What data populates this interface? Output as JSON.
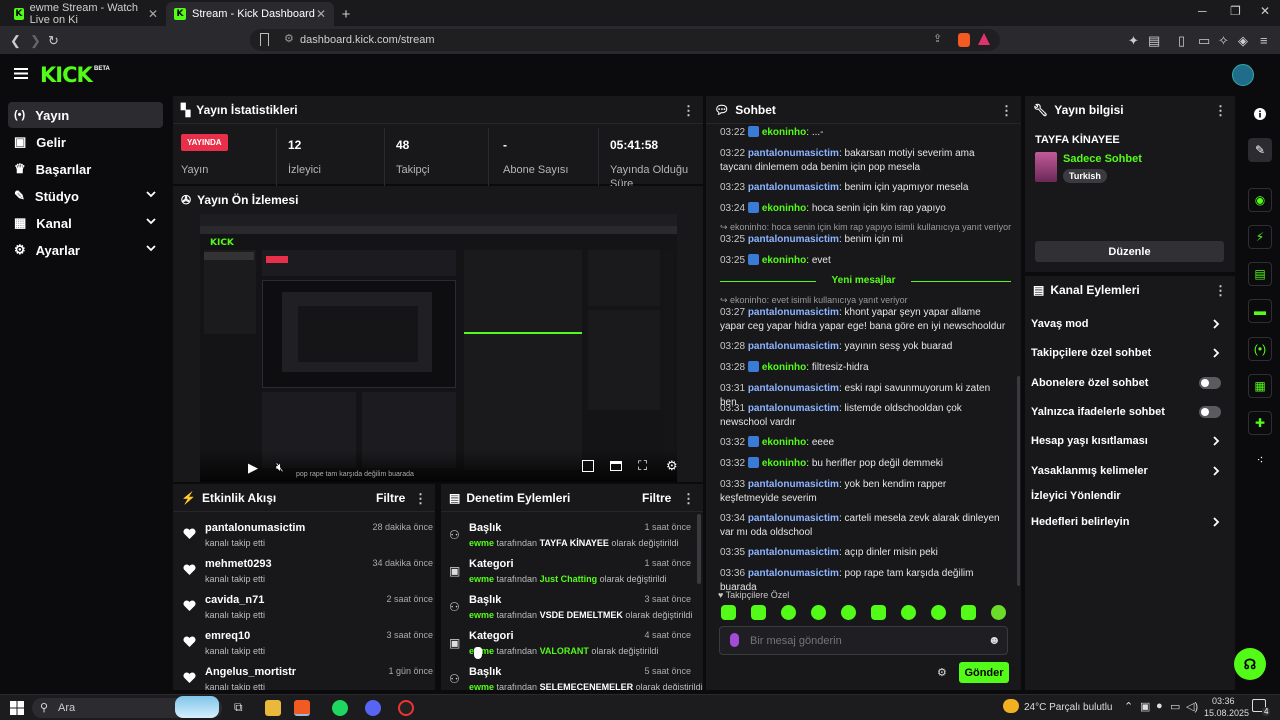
{
  "browser": {
    "tabs": [
      {
        "title": "ewme Stream - Watch Live on Ki"
      },
      {
        "title": "Stream - Kick Dashboard"
      }
    ],
    "url": "dashboard.kick.com/stream"
  },
  "site": {
    "logo": "KICK",
    "beta": "BETA"
  },
  "sidebar": {
    "items": [
      {
        "label": "Yayın",
        "icon": "broadcast-icon"
      },
      {
        "label": "Gelir",
        "icon": "money-icon"
      },
      {
        "label": "Başarılar",
        "icon": "trophy-icon"
      },
      {
        "label": "Stüdyo",
        "icon": "studio-icon"
      },
      {
        "label": "Kanal",
        "icon": "channel-icon"
      },
      {
        "label": "Ayarlar",
        "icon": "gear-icon"
      }
    ]
  },
  "stats": {
    "title": "Yayın İstatistikleri",
    "live_badge": "YAYINDA",
    "live_label": "Yayın",
    "viewers": {
      "value": "12",
      "label": "İzleyici"
    },
    "followers": {
      "value": "48",
      "label": "Takipçi"
    },
    "subs": {
      "value": "-",
      "label": "Abone Sayısı"
    },
    "uptime": {
      "value": "05:41:58",
      "label1": "Yayında Olduğu",
      "label2": "Süre"
    }
  },
  "preview": {
    "title": "Yayın Ön İzlemesi",
    "caption": "pop rape tam karşıda değilim buarada"
  },
  "activity": {
    "title": "Etkinlik Akışı",
    "filter": "Filtre",
    "items": [
      {
        "name": "pantalonumasictim",
        "sub": "kanalı takip etti",
        "time": "28 dakika önce"
      },
      {
        "name": "mehmet0293",
        "sub": "kanalı takip etti",
        "time": "34 dakika önce"
      },
      {
        "name": "cavida_n71",
        "sub": "kanalı takip etti",
        "time": "2 saat önce"
      },
      {
        "name": "emreq10",
        "sub": "kanalı takip etti",
        "time": "3 saat önce"
      },
      {
        "name": "Angelus_mortistr",
        "sub": "kanalı takip etti",
        "time": "1 gün önce"
      }
    ]
  },
  "moderation": {
    "title": "Denetim Eylemleri",
    "filter": "Filtre",
    "items": [
      {
        "name": "Başlık",
        "user": "ewme",
        "mid": " tarafından ",
        "value": "TAYFA KİNAYEE",
        "tail": " olarak değiştirildi",
        "time": "1 saat önce",
        "icon": "user-edit-icon"
      },
      {
        "name": "Kategori",
        "user": "ewme",
        "mid": " tarafından ",
        "value": "Just Chatting",
        "tail": " olarak değiştirildi",
        "time": "1 saat önce",
        "icon": "category-icon"
      },
      {
        "name": "Başlık",
        "user": "ewme",
        "mid": " tarafından ",
        "value": "VSDE DEMELTMEK",
        "tail": " olarak değiştirildi",
        "time": "3 saat önce",
        "icon": "user-edit-icon"
      },
      {
        "name": "Kategori",
        "user": "ewme",
        "mid": " tarafından ",
        "value": "VALORANT",
        "tail": " olarak değiştirildi",
        "time": "4 saat önce",
        "icon": "category-icon"
      },
      {
        "name": "Başlık",
        "user": "ewme",
        "mid": " tarafından ",
        "value": "SELEMECENEMELER",
        "tail": " olarak değiştirildi",
        "time": "5 saat önce",
        "icon": "user-edit-icon"
      }
    ]
  },
  "chat": {
    "title": "Sohbet",
    "new_messages": "Yeni mesajlar",
    "messages": [
      {
        "time": "03:22",
        "user": "ekoninho",
        "text": ": ...-",
        "verified": true
      },
      {
        "time": "03:22",
        "user": "pantalonumasictim",
        "text": ": bakarsan motiyi severim ama taycanı dinlemem oda benim için pop mesela",
        "verified": false
      },
      {
        "time": "03:23",
        "user": "pantalonumasictim",
        "text": ": benim için yapmıyor mesela",
        "verified": false
      },
      {
        "time": "03:24",
        "user": "ekoninho",
        "text": ": hoca senin için kim rap yapıyo",
        "verified": true
      },
      {
        "reply": "↪ ekoninho: hoca senin için kim rap yapıyo isimli kullanıcıya yanıt veriyor"
      },
      {
        "time": "03:25",
        "user": "pantalonumasictim",
        "text": ": benim için mi",
        "verified": false
      },
      {
        "time": "03:25",
        "user": "ekoninho",
        "text": ": evet",
        "verified": true
      },
      {
        "reply": "↪ ekoninho: evet isimli kullanıcıya yanıt veriyor"
      },
      {
        "time": "03:27",
        "user": "pantalonumasictim",
        "text": ": khont yapar şeyn yapar allame yapar ceg yapar hidra yapar ege! bana göre en iyi newschooldur",
        "verified": false
      },
      {
        "time": "03:28",
        "user": "pantalonumasictim",
        "text": ": yayının sesş yok buarad",
        "verified": false
      },
      {
        "time": "03:28",
        "user": "ekoninho",
        "text": ": filtresiz-hidra",
        "verified": true
      },
      {
        "time": "03:31",
        "user": "pantalonumasictim",
        "text": ": eski rapi savunmuyorum ki zaten ben",
        "verified": false
      },
      {
        "time": "03:31",
        "user": "pantalonumasictim",
        "text": ": listemde oldschooldan çok newschool vardır",
        "verified": false
      },
      {
        "time": "03:32",
        "user": "ekoninho",
        "text": ": eeee",
        "verified": true
      },
      {
        "time": "03:32",
        "user": "ekoninho",
        "text": ": bu herifler pop değil demmeki",
        "verified": true
      },
      {
        "time": "03:33",
        "user": "pantalonumasictim",
        "text": ": yok ben kendim rapper keşfetmeyide severim",
        "verified": false
      },
      {
        "time": "03:34",
        "user": "pantalonumasictim",
        "text": ": carteli mesela zevk alarak dinleyen var mı oda oldschool",
        "verified": false
      },
      {
        "time": "03:35",
        "user": "pantalonumasictim",
        "text": ": açıp dinler misin peki",
        "verified": false
      },
      {
        "time": "03:36",
        "user": "pantalonumasictim",
        "text": ": pop rape tam karşıda değilim buarada",
        "verified": false
      }
    ],
    "followers_only": "♥ Takipçilere Özel",
    "input_placeholder": "Bir mesaj gönderin",
    "send": "Gönder"
  },
  "stream_info": {
    "title": "Yayın bilgisi",
    "stream_title": "TAYFA KİNAYEE",
    "category": "Sadece Sohbet",
    "language": "Turkish",
    "edit": "Düzenle"
  },
  "channel_actions": {
    "title": "Kanal Eylemleri",
    "items": [
      {
        "label": "Yavaş mod",
        "control": "chevron"
      },
      {
        "label": "Takipçilere özel sohbet",
        "control": "chevron"
      },
      {
        "label": "Abonelere özel sohbet",
        "control": "toggle",
        "on": false
      },
      {
        "label": "Yalnızca ifadelerle sohbet",
        "control": "toggle",
        "on": false
      },
      {
        "label": "Hesap yaşı kısıtlaması",
        "control": "chevron"
      },
      {
        "label": "Yasaklanmış kelimeler",
        "control": "chevron"
      },
      {
        "label": "İzleyici Yönlendir",
        "control": "none"
      },
      {
        "label": "Hedefleri belirleyin",
        "control": "chevron"
      }
    ]
  },
  "taskbar": {
    "search": "Ara",
    "weather": "24°C  Parçalı bulutlu",
    "time": "03:36",
    "date": "15.08.2025",
    "notif_count": "4"
  },
  "colors": {
    "accent": "#53fc18",
    "live": "#e8304a",
    "panel": "#18181b",
    "bg": "#0b0b0d"
  }
}
